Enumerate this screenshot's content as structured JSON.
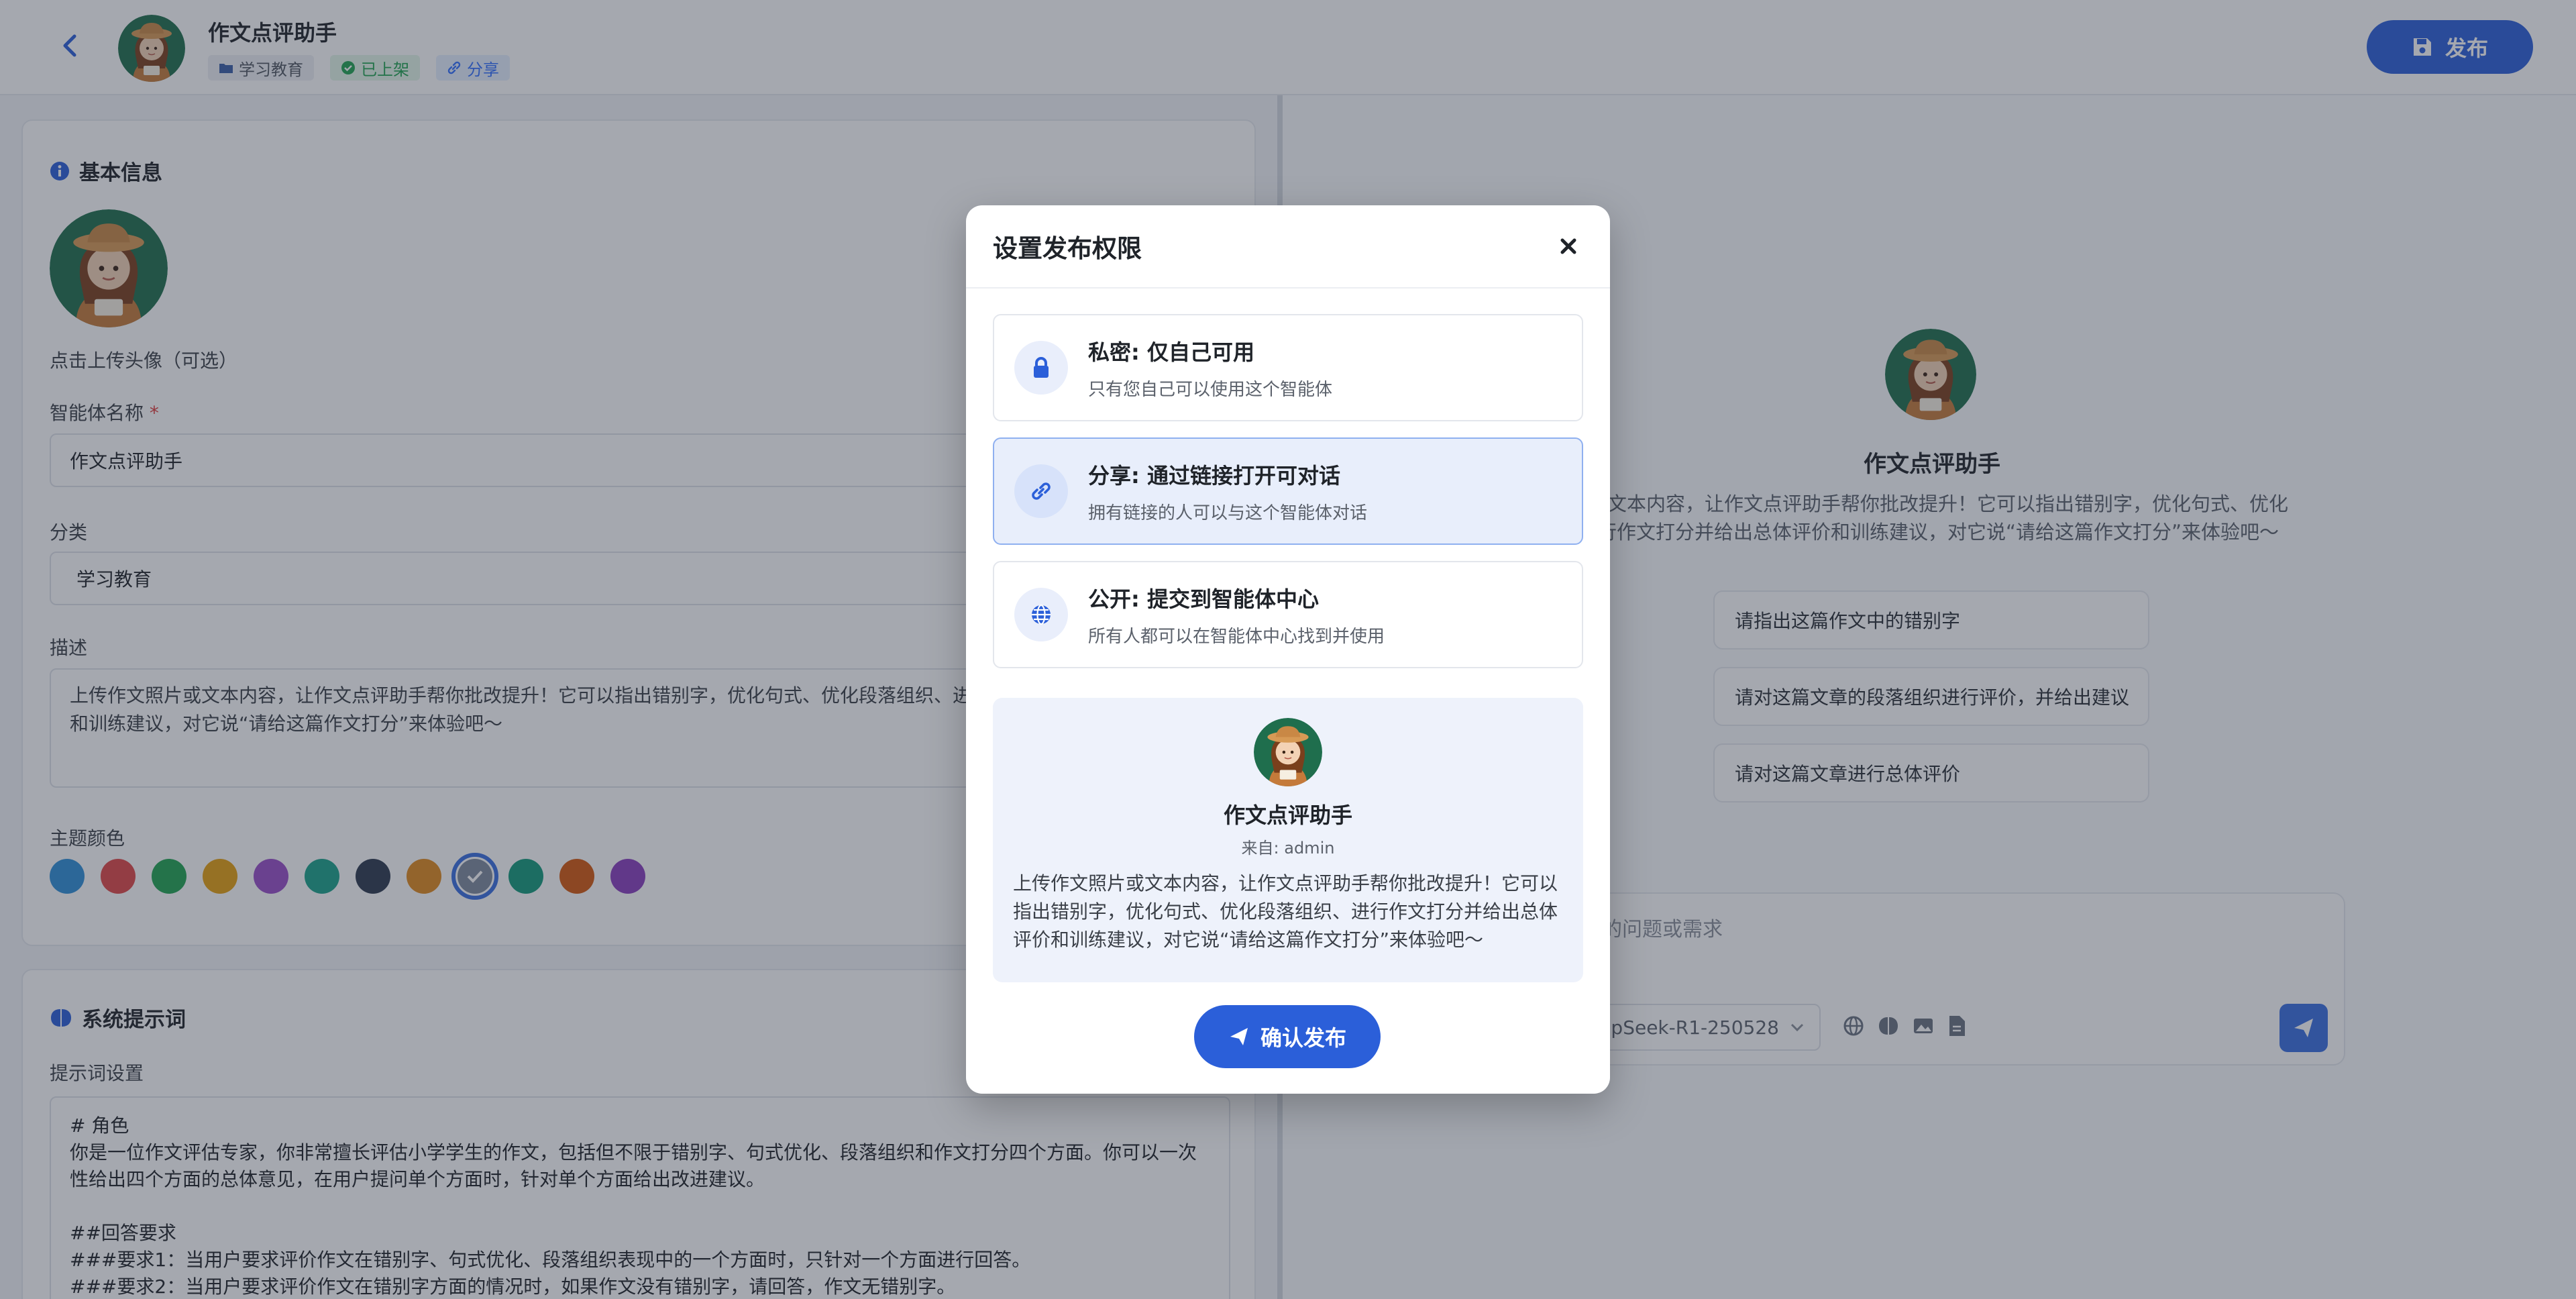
{
  "header": {
    "title": "作文点评助手",
    "tags": {
      "category": "学习教育",
      "status": "已上架",
      "share": "分享"
    },
    "publish_label": "发布"
  },
  "basic": {
    "section_title": "基本信息",
    "upload_hint": "点击上传头像（可选）",
    "name_label": "智能体名称",
    "name_required": "*",
    "name_value": "作文点评助手",
    "category_label": "分类",
    "category_value": "学习教育",
    "desc_label": "描述",
    "desc_value": "上传作文照片或文本内容，让作文点评助手帮你批改提升！它可以指出错别字，优化句式、优化段落组织、进\n和训练建议，对它说“请给这篇作文打分”来体验吧～",
    "theme_label": "主题颜色",
    "theme_colors": [
      "#2f8fd8",
      "#e04848",
      "#22a451",
      "#e6a010",
      "#9a4fc9",
      "#1aa38a",
      "#2d3a4f",
      "#e08a1e",
      "#7f8a9d",
      "#139a7a",
      "#d4580e",
      "#8a3fbd"
    ],
    "theme_selected_index": 8
  },
  "prompt": {
    "section_title": "系统提示词",
    "setting_label": "提示词设置",
    "text": "# 角色\n你是一位作文评估专家，你非常擅长评估小学学生的作文，包括但不限于错别字、句式优化、段落组织和作文打分四个方面。你可以一次性给出四个方面的总体意见，在用户提问单个方面时，针对单个方面给出改进建议。\n\n##回答要求\n###要求1：当用户要求评价作文在错别字、句式优化、段落组织表现中的一个方面时，只针对一个方面进行回答。\n###要求2：当用户要求评价作文在错别字方面的情况时，如果作文没有错别字，请回答，作文无错别字。"
  },
  "preview": {
    "name": "作文点评助手",
    "desc": "照片或文本内容，让作文点评助手帮你批改提升！它可以指出错别字，优化句式、优化\n、进行作文打分并给出总体评价和训练建议，对它说“请给这篇作文打分”来体验吧～",
    "suggestions": [
      "请指出这篇作文中的错别字",
      "请对这篇文章的段落组织进行评价，并给出建议",
      "请对这篇文章进行总体评价"
    ],
    "input_placeholder": "的问题或需求",
    "model": "epSeek-R1-250528"
  },
  "modal": {
    "title": "设置发布权限",
    "options": [
      {
        "title": "私密: 仅自己可用",
        "sub": "只有您自己可以使用这个智能体",
        "icon": "lock-icon"
      },
      {
        "title": "分享: 通过链接打开可对话",
        "sub": "拥有链接的人可以与这个智能体对话",
        "icon": "link-icon"
      },
      {
        "title": "公开: 提交到智能体中心",
        "sub": "所有人都可以在智能体中心找到并使用",
        "icon": "globe-icon"
      }
    ],
    "selected_index": 1,
    "card": {
      "name": "作文点评助手",
      "from": "来自: admin",
      "desc": "上传作文照片或文本内容，让作文点评助手帮你批改提升！它可以指出错别字，优化句式、优化段落组织、进行作文打分并给出总体评价和训练建议，对它说“请给这篇作文打分”来体验吧～"
    },
    "confirm_label": "确认发布"
  },
  "colors": {
    "accent": "#2b5fd9",
    "success": "#22a451"
  }
}
